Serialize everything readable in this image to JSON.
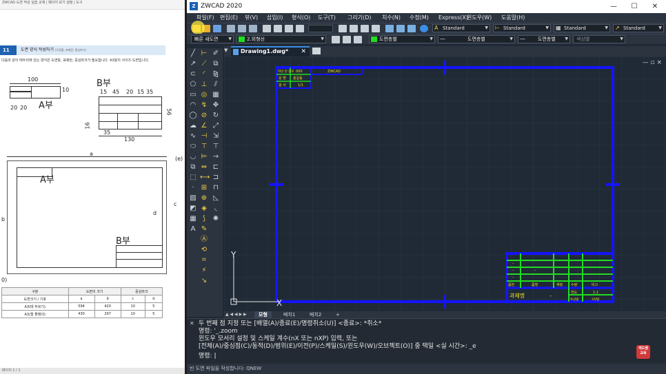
{
  "document": {
    "topbar": "ZWCAD 도면 작성 실습 교재 | 페이지 보기 설정 | 도구",
    "section_number": "11",
    "section_title": "도면 양식 작성하기",
    "section_sub": "(도면틀, 표제란, 중심마크)",
    "intro": "다음과 같이 테두리에 있는 양식은 도면틀, 표제란, 중심마크가 필요합니다. A3용지 사이즈 도면입니다.",
    "label_a": "A부",
    "label_b": "B부",
    "label_a2": "A부",
    "label_b2": "B부",
    "dims": {
      "d100": "100",
      "d10": "10",
      "d20a": "20",
      "d20b": "20",
      "d15a": "15",
      "d45": "45",
      "d20c": "20",
      "d15b": "15",
      "d35a": "35",
      "d56": "56",
      "d16": "16",
      "d35b": "35",
      "d130": "130",
      "da": "a",
      "db": "b",
      "dc": "c",
      "dd": "d",
      "de": "(e)",
      "dout": "0)"
    },
    "table": {
      "h1": "구분",
      "h2": "도면의 크기",
      "h3": "중심마크",
      "sub": "도면크기",
      "sub_sym": "기호",
      "cols": [
        "a",
        "b",
        "c",
        "d"
      ],
      "rows": [
        {
          "name": "A3(테 두르기)",
          "v": [
            "594",
            "420",
            "10",
            "5"
          ]
        },
        {
          "name": "A3(철 할때의)",
          "v": [
            "430",
            "297",
            "10",
            "5"
          ]
        }
      ]
    },
    "bottom": "페이지 1 / 1"
  },
  "app": {
    "title": "ZWCAD 2020",
    "window_buttons": [
      "—",
      "☐",
      "✕"
    ],
    "menu": [
      "파일(F)",
      "편집(E)",
      "뷰(V)",
      "삽입(I)",
      "형식(O)",
      "도구(T)",
      "그리기(D)",
      "치수(N)",
      "수정(M)",
      "Express(X)",
      "윈도우(W)",
      "도움말(H)"
    ],
    "style_combos": [
      "Standard",
      "Standard",
      "Standard",
      "Standard"
    ],
    "quick_style": "빠른 새도면",
    "layer_combo": "2.외형선",
    "color_combo": "도면층별",
    "linetype_combo": "도면층별",
    "lineweight_combo": "도면층별",
    "plotstyle_combo": "색상별",
    "tab_name": "Drawing1.dwg*",
    "canvas_ctrl": "— ▫ ×",
    "titleblock_top": {
      "school": "학년 반 번호",
      "num": "000",
      "app": "ZWCAD",
      "name": "성 명",
      "name_val": "홍길동",
      "check": "검 사",
      "check_val": "1/1"
    },
    "titleblock_bottom": {
      "rows": [
        "-",
        "-",
        "-",
        "-"
      ],
      "headers": [
        "품번",
        "품명",
        "재질",
        "수량",
        "비고"
      ],
      "project": "과제명",
      "dash": "-",
      "scale_lbl": "척도",
      "scale_val": "1:1",
      "method_lbl": "투상법",
      "method_val": "3각법"
    },
    "ucs": {
      "x": "X",
      "y": "Y"
    },
    "layout_tabs": [
      "모형",
      "배치1",
      "배치2",
      "+"
    ],
    "commands": [
      "두 번째 점 지정 또는 [배열(A)/종료(E)/명령취소(U)] <종료>: *취소*",
      "명령: '_.zoom",
      "윈도우 모서리 설정 및 스케일 계수(nX 또는 nXP) 입력, 또는",
      "[전체(A)/중심점(C)/동적(D)/범위(E)/이전(P)/스케일(S)/윈도우(W)/오브젝트(O)] 중 택일 <실 시간>: _e",
      "명령:"
    ],
    "badge": "캐드쌤 교육",
    "status": "빈 도면 파일을 작성합니다:  QNEW"
  },
  "colors": {
    "frame": "#1414ff",
    "green": "#22dd22",
    "yellow": "#f0e020",
    "canvas": "#1f2a36"
  }
}
